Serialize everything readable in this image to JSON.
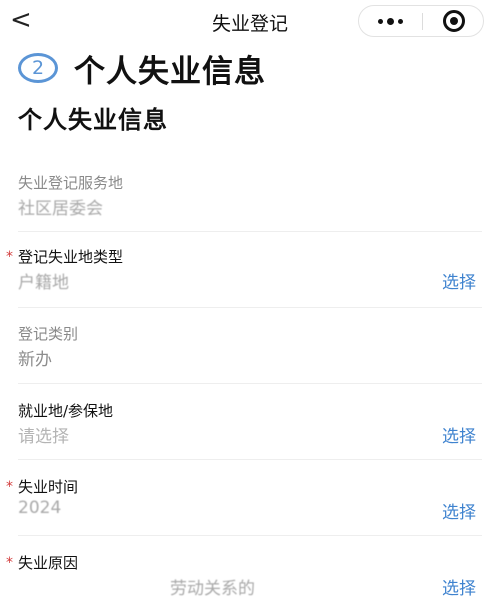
{
  "nav": {
    "back_glyph": "<",
    "title": "失业登记",
    "more_icon": "more-dots-icon",
    "close_icon": "target-close-icon"
  },
  "step": {
    "number": "2",
    "title": "个人失业信息"
  },
  "section_title": "个人失业信息",
  "fields": [
    {
      "label": "失业登记服务地",
      "value": "社区居委会",
      "required": false,
      "action": ""
    },
    {
      "label": "登记失业地类型",
      "value": "户籍地",
      "required": true,
      "action": "选择"
    },
    {
      "label": "登记类别",
      "value": "新办",
      "required": false,
      "action": ""
    },
    {
      "label": "就业地/参保地",
      "value": "请选择",
      "required": false,
      "action": "选择"
    },
    {
      "label": "失业时间",
      "value": "2024",
      "required": true,
      "action": "选择"
    },
    {
      "label": "失业原因",
      "value": "劳动关系的",
      "required": true,
      "action": "选择"
    }
  ],
  "required_mark": "*",
  "colors": {
    "accent": "#3f83cf",
    "step_ring": "#5b95d6",
    "required": "#d23b3b"
  }
}
